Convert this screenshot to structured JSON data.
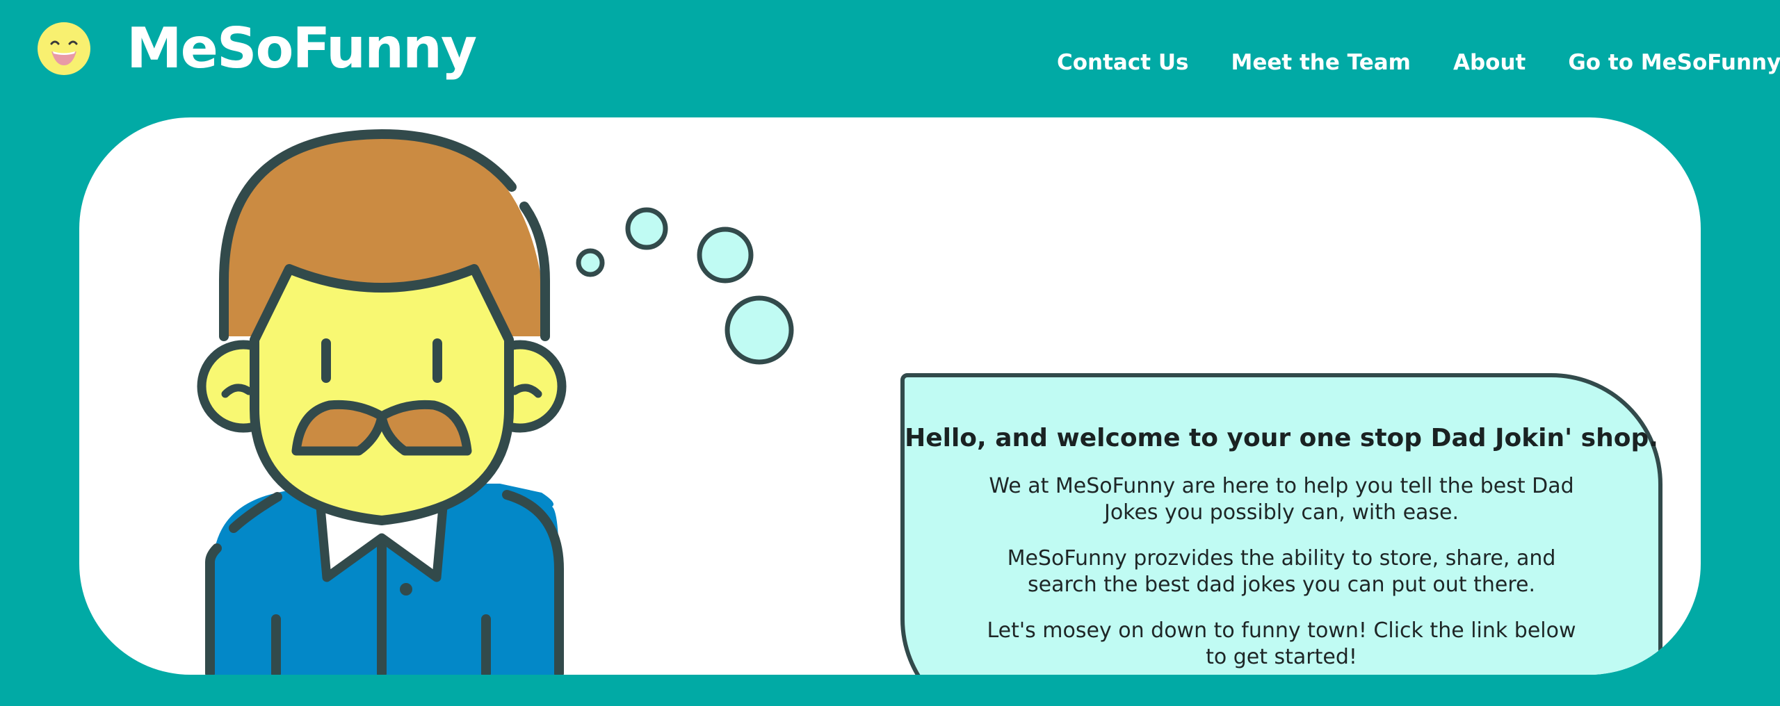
{
  "brand": {
    "name": "MeSoFunny",
    "logo_icon": "laughing-face-icon",
    "logo_color": "#f8f070"
  },
  "nav": {
    "items": [
      {
        "label": "Contact Us"
      },
      {
        "label": "Meet the Team"
      },
      {
        "label": "About"
      },
      {
        "label": "Go to MeSoFunny"
      }
    ]
  },
  "hero": {
    "illustration": "dad-with-mustache-icon",
    "heading": "Hello, and welcome to your one stop Dad Jokin' shop.",
    "paragraphs": [
      "We at MeSoFunny are here to help you tell the best Dad Jokes you possibly can, with ease.",
      "MeSoFunny prozvides the ability to store, share, and search the best dad jokes you can put out there.",
      "Let's mosey on down to funny town! Click the link below to get started!"
    ]
  },
  "colors": {
    "background": "#01aaa5",
    "card": "#ffffff",
    "bubble": "#c0fbf3",
    "outline": "#324a4b",
    "hair": "#cb8b42",
    "skin": "#f8f872",
    "shirt": "#0388c8"
  }
}
